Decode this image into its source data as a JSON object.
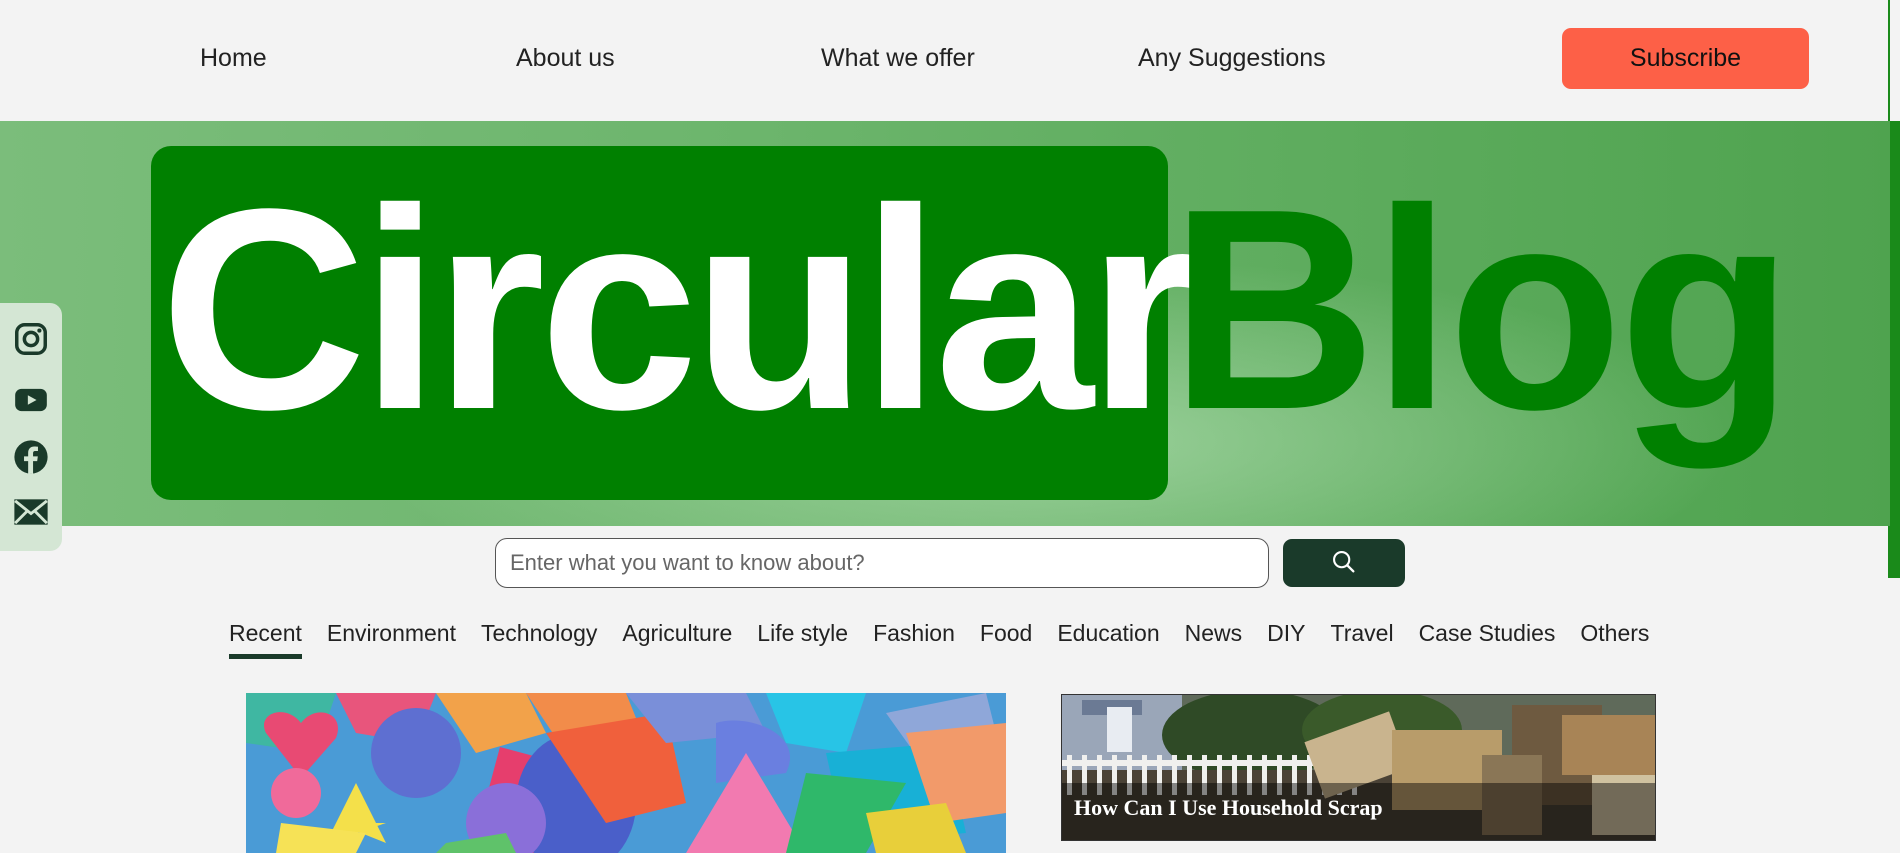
{
  "nav": {
    "links": [
      "Home",
      "About us",
      "What we offer",
      "Any Suggestions"
    ],
    "subscribe_label": "Subscribe"
  },
  "hero": {
    "logo_word1": "Circular",
    "logo_word2": "Blog"
  },
  "social": {
    "icons": [
      "instagram-icon",
      "youtube-icon",
      "facebook-icon",
      "email-icon"
    ]
  },
  "search": {
    "placeholder": "Enter what you want to know about?",
    "value": "",
    "button_icon": "search-icon"
  },
  "categories": {
    "active": "Recent",
    "items": [
      "Recent",
      "Environment",
      "Technology",
      "Agriculture",
      "Life style",
      "Fashion",
      "Food",
      "Education",
      "News",
      "DIY",
      "Travel",
      "Case Studies",
      "Others"
    ]
  },
  "cards": {
    "featured_image": "colorful-paper-shapes",
    "side_title": "How Can I Use Household Scrap"
  },
  "colors": {
    "brand_green": "#008000",
    "subscribe": "#fd6047",
    "dark_green": "#1a3a2a"
  }
}
